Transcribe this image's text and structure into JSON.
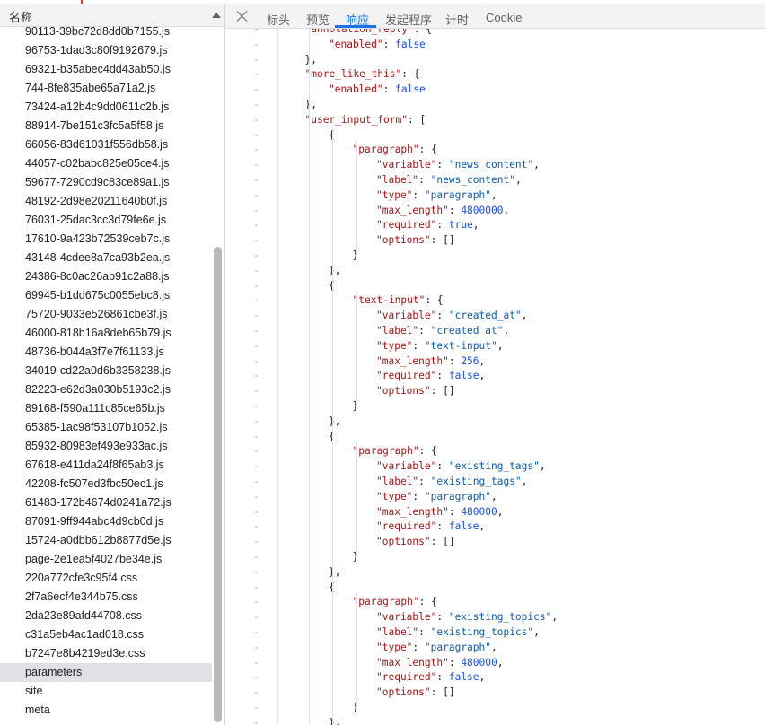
{
  "names_panel": {
    "header": "名称",
    "files": [
      "90113-39bc72d8dd0b7155.js",
      "96753-1dad3c80f9192679.js",
      "69321-b35abec4dd43ab50.js",
      "744-8fe835abe65a71a2.js",
      "73424-a12b4c9dd0611c2b.js",
      "88914-7be151c3fc5a5f58.js",
      "66056-83d61031f556db58.js",
      "44057-c02babc825e05ce4.js",
      "59677-7290cd9c83ce89a1.js",
      "48192-2d98e20211640b0f.js",
      "76031-25dac3cc3d79fe6e.js",
      "17610-9a423b72539ceb7c.js",
      "43148-4cdee8a7ca93b2ea.js",
      "24386-8c0ac26ab91c2a88.js",
      "69945-b1dd675c0055ebc8.js",
      "75720-9033e526861cbe3f.js",
      "46000-818b16a8deb65b79.js",
      "48736-b044a3f7e7f61133.js",
      "34019-cd22a0d6b3358238.js",
      "82223-e62d3a030b5193c2.js",
      "89168-f590a111c85ce65b.js",
      "65385-1ac98f53107b1052.js",
      "85932-80983ef493e933ac.js",
      "67618-e411da24f8f65ab3.js",
      "42208-fc507ed3fbc50ec1.js",
      "61483-172b4674d0241a72.js",
      "87091-9ff944abc4d9cb0d.js",
      "15724-a0dbb612b8877d5e.js",
      "page-2e1ea5f4027be34e.js",
      "220a772cfe3c95f4.css",
      "2f7a6ecf4e344b75.css",
      "2da23e89afd44708.css",
      "c31a5eb4ac1ad018.css",
      "b7247e8b4219ed3e.css",
      "parameters",
      "site",
      "meta"
    ],
    "selected_index": 34
  },
  "tabs": {
    "items": [
      "标头",
      "预览",
      "响应",
      "发起程序",
      "计时",
      "Cookie"
    ],
    "active": "响应",
    "close_icon": "close-icon"
  },
  "colors": {
    "key": "#a31515",
    "string": "#0b5cad",
    "number": "#1750eb",
    "active_tab": "#1a73e8",
    "selected_row": "#dfe1e5"
  },
  "code": {
    "lines": [
      {
        "indent": 1,
        "tokens": [
          [
            "k",
            "\"annotation_reply\""
          ],
          [
            "p",
            ": {"
          ]
        ]
      },
      {
        "indent": 2,
        "tokens": [
          [
            "k",
            "\"enabled\""
          ],
          [
            "p",
            ": "
          ],
          [
            "b",
            "false"
          ]
        ]
      },
      {
        "indent": 1,
        "tokens": [
          [
            "p",
            "},"
          ]
        ]
      },
      {
        "indent": 1,
        "tokens": [
          [
            "k",
            "\"more_like_this\""
          ],
          [
            "p",
            ": {"
          ]
        ]
      },
      {
        "indent": 2,
        "tokens": [
          [
            "k",
            "\"enabled\""
          ],
          [
            "p",
            ": "
          ],
          [
            "b",
            "false"
          ]
        ]
      },
      {
        "indent": 1,
        "tokens": [
          [
            "p",
            "},"
          ]
        ]
      },
      {
        "indent": 1,
        "tokens": [
          [
            "k",
            "\"user_input_form\""
          ],
          [
            "p",
            ": ["
          ]
        ]
      },
      {
        "indent": 2,
        "tokens": [
          [
            "p",
            "{"
          ]
        ]
      },
      {
        "indent": 3,
        "tokens": [
          [
            "k",
            "\"paragraph\""
          ],
          [
            "p",
            ": {"
          ]
        ]
      },
      {
        "indent": 4,
        "tokens": [
          [
            "k",
            "\"variable\""
          ],
          [
            "p",
            ": "
          ],
          [
            "s",
            "\"news_content\""
          ],
          [
            "p",
            ","
          ]
        ]
      },
      {
        "indent": 4,
        "tokens": [
          [
            "k",
            "\"label\""
          ],
          [
            "p",
            ": "
          ],
          [
            "s",
            "\"news_content\""
          ],
          [
            "p",
            ","
          ]
        ]
      },
      {
        "indent": 4,
        "tokens": [
          [
            "k",
            "\"type\""
          ],
          [
            "p",
            ": "
          ],
          [
            "s",
            "\"paragraph\""
          ],
          [
            "p",
            ","
          ]
        ]
      },
      {
        "indent": 4,
        "tokens": [
          [
            "k",
            "\"max_length\""
          ],
          [
            "p",
            ": "
          ],
          [
            "n",
            "4800000"
          ],
          [
            "p",
            ","
          ]
        ]
      },
      {
        "indent": 4,
        "tokens": [
          [
            "k",
            "\"required\""
          ],
          [
            "p",
            ": "
          ],
          [
            "b",
            "true"
          ],
          [
            "p",
            ","
          ]
        ]
      },
      {
        "indent": 4,
        "tokens": [
          [
            "k",
            "\"options\""
          ],
          [
            "p",
            ": []"
          ]
        ]
      },
      {
        "indent": 3,
        "tokens": [
          [
            "p",
            "}"
          ]
        ]
      },
      {
        "indent": 2,
        "tokens": [
          [
            "p",
            "},"
          ]
        ]
      },
      {
        "indent": 2,
        "tokens": [
          [
            "p",
            "{"
          ]
        ]
      },
      {
        "indent": 3,
        "tokens": [
          [
            "k",
            "\"text-input\""
          ],
          [
            "p",
            ": {"
          ]
        ]
      },
      {
        "indent": 4,
        "tokens": [
          [
            "k",
            "\"variable\""
          ],
          [
            "p",
            ": "
          ],
          [
            "s",
            "\"created_at\""
          ],
          [
            "p",
            ","
          ]
        ]
      },
      {
        "indent": 4,
        "tokens": [
          [
            "k",
            "\"label\""
          ],
          [
            "p",
            ": "
          ],
          [
            "s",
            "\"created_at\""
          ],
          [
            "p",
            ","
          ]
        ]
      },
      {
        "indent": 4,
        "tokens": [
          [
            "k",
            "\"type\""
          ],
          [
            "p",
            ": "
          ],
          [
            "s",
            "\"text-input\""
          ],
          [
            "p",
            ","
          ]
        ]
      },
      {
        "indent": 4,
        "tokens": [
          [
            "k",
            "\"max_length\""
          ],
          [
            "p",
            ": "
          ],
          [
            "n",
            "256"
          ],
          [
            "p",
            ","
          ]
        ]
      },
      {
        "indent": 4,
        "tokens": [
          [
            "k",
            "\"required\""
          ],
          [
            "p",
            ": "
          ],
          [
            "b",
            "false"
          ],
          [
            "p",
            ","
          ]
        ]
      },
      {
        "indent": 4,
        "tokens": [
          [
            "k",
            "\"options\""
          ],
          [
            "p",
            ": []"
          ]
        ]
      },
      {
        "indent": 3,
        "tokens": [
          [
            "p",
            "}"
          ]
        ]
      },
      {
        "indent": 2,
        "tokens": [
          [
            "p",
            "},"
          ]
        ]
      },
      {
        "indent": 2,
        "tokens": [
          [
            "p",
            "{"
          ]
        ]
      },
      {
        "indent": 3,
        "tokens": [
          [
            "k",
            "\"paragraph\""
          ],
          [
            "p",
            ": {"
          ]
        ]
      },
      {
        "indent": 4,
        "tokens": [
          [
            "k",
            "\"variable\""
          ],
          [
            "p",
            ": "
          ],
          [
            "s",
            "\"existing_tags\""
          ],
          [
            "p",
            ","
          ]
        ]
      },
      {
        "indent": 4,
        "tokens": [
          [
            "k",
            "\"label\""
          ],
          [
            "p",
            ": "
          ],
          [
            "s",
            "\"existing_tags\""
          ],
          [
            "p",
            ","
          ]
        ]
      },
      {
        "indent": 4,
        "tokens": [
          [
            "k",
            "\"type\""
          ],
          [
            "p",
            ": "
          ],
          [
            "s",
            "\"paragraph\""
          ],
          [
            "p",
            ","
          ]
        ]
      },
      {
        "indent": 4,
        "tokens": [
          [
            "k",
            "\"max_length\""
          ],
          [
            "p",
            ": "
          ],
          [
            "n",
            "480000"
          ],
          [
            "p",
            ","
          ]
        ]
      },
      {
        "indent": 4,
        "tokens": [
          [
            "k",
            "\"required\""
          ],
          [
            "p",
            ": "
          ],
          [
            "b",
            "false"
          ],
          [
            "p",
            ","
          ]
        ]
      },
      {
        "indent": 4,
        "tokens": [
          [
            "k",
            "\"options\""
          ],
          [
            "p",
            ": []"
          ]
        ]
      },
      {
        "indent": 3,
        "tokens": [
          [
            "p",
            "}"
          ]
        ]
      },
      {
        "indent": 2,
        "tokens": [
          [
            "p",
            "},"
          ]
        ]
      },
      {
        "indent": 2,
        "tokens": [
          [
            "p",
            "{"
          ]
        ]
      },
      {
        "indent": 3,
        "tokens": [
          [
            "k",
            "\"paragraph\""
          ],
          [
            "p",
            ": {"
          ]
        ]
      },
      {
        "indent": 4,
        "tokens": [
          [
            "k",
            "\"variable\""
          ],
          [
            "p",
            ": "
          ],
          [
            "s",
            "\"existing_topics\""
          ],
          [
            "p",
            ","
          ]
        ]
      },
      {
        "indent": 4,
        "tokens": [
          [
            "k",
            "\"label\""
          ],
          [
            "p",
            ": "
          ],
          [
            "s",
            "\"existing_topics\""
          ],
          [
            "p",
            ","
          ]
        ]
      },
      {
        "indent": 4,
        "tokens": [
          [
            "k",
            "\"type\""
          ],
          [
            "p",
            ": "
          ],
          [
            "s",
            "\"paragraph\""
          ],
          [
            "p",
            ","
          ]
        ]
      },
      {
        "indent": 4,
        "tokens": [
          [
            "k",
            "\"max_length\""
          ],
          [
            "p",
            ": "
          ],
          [
            "n",
            "480000"
          ],
          [
            "p",
            ","
          ]
        ]
      },
      {
        "indent": 4,
        "tokens": [
          [
            "k",
            "\"required\""
          ],
          [
            "p",
            ": "
          ],
          [
            "b",
            "false"
          ],
          [
            "p",
            ","
          ]
        ]
      },
      {
        "indent": 4,
        "tokens": [
          [
            "k",
            "\"options\""
          ],
          [
            "p",
            ": []"
          ]
        ]
      },
      {
        "indent": 3,
        "tokens": [
          [
            "p",
            "}"
          ]
        ]
      },
      {
        "indent": 2,
        "tokens": [
          [
            "p",
            "},"
          ]
        ]
      }
    ]
  }
}
